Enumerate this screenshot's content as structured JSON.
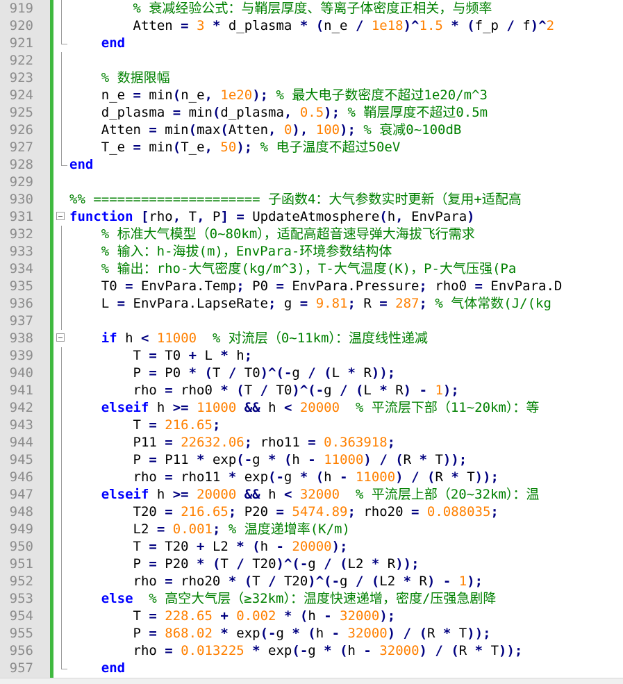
{
  "colors": {
    "keyword": "#0000ff",
    "operator": "#00007f",
    "number": "#ff8000",
    "comment": "#008000",
    "text": "#000000",
    "line_number": "#8c8c8c",
    "gutter": "#e4e4e4",
    "change_bar": "#3fb93f"
  },
  "lines": [
    {
      "n": "919",
      "fold": "vline",
      "html": "        <span class=\"cmt\">% 衰减经验公式：与鞘层厚度、等离子体密度正相关，与频率</span>"
    },
    {
      "n": "920",
      "fold": "vline",
      "html": "        Atten <span class=\"op\">=</span> <span class=\"num\">3</span> <span class=\"op\">*</span> d_plasma <span class=\"op\">*</span> <span class=\"op\">(</span>n_e <span class=\"op\">/</span> <span class=\"num\">1e18</span><span class=\"op\">)^</span><span class=\"num\">1.5</span> <span class=\"op\">*</span> <span class=\"op\">(</span>f_p <span class=\"op\">/</span> f<span class=\"op\">)^</span><span class=\"num\">2</span>"
    },
    {
      "n": "921",
      "fold": "end",
      "html": "    <span class=\"kw\">end</span>"
    },
    {
      "n": "922",
      "fold": "vline",
      "html": ""
    },
    {
      "n": "923",
      "fold": "vline",
      "html": "    <span class=\"cmt\">% 数据限幅</span>"
    },
    {
      "n": "924",
      "fold": "vline",
      "html": "    n_e <span class=\"op\">=</span> min<span class=\"op\">(</span>n_e<span class=\"op\">,</span> <span class=\"num\">1e20</span><span class=\"op\">);</span> <span class=\"cmt\">% 最大电子数密度不超过1e20/m^3</span>"
    },
    {
      "n": "925",
      "fold": "vline",
      "html": "    d_plasma <span class=\"op\">=</span> min<span class=\"op\">(</span>d_plasma<span class=\"op\">,</span> <span class=\"num\">0.5</span><span class=\"op\">);</span> <span class=\"cmt\">% 鞘层厚度不超过0.5m</span>"
    },
    {
      "n": "926",
      "fold": "vline",
      "html": "    Atten <span class=\"op\">=</span> min<span class=\"op\">(</span>max<span class=\"op\">(</span>Atten<span class=\"op\">,</span> <span class=\"num\">0</span><span class=\"op\">),</span> <span class=\"num\">100</span><span class=\"op\">);</span> <span class=\"cmt\">% 衰减0~100dB</span>"
    },
    {
      "n": "927",
      "fold": "vline",
      "html": "    T_e <span class=\"op\">=</span> min<span class=\"op\">(</span>T_e<span class=\"op\">,</span> <span class=\"num\">50</span><span class=\"op\">);</span> <span class=\"cmt\">% 电子温度不超过50eV</span>"
    },
    {
      "n": "928",
      "fold": "end",
      "html": "<span class=\"kw\">end</span>"
    },
    {
      "n": "929",
      "fold": "",
      "html": ""
    },
    {
      "n": "930",
      "fold": "",
      "html": "<span class=\"cmt\">%% ===================== 子函数4：大气参数实时更新（复用+适配高</span>"
    },
    {
      "n": "931",
      "fold": "box",
      "html": "<span class=\"kw\">function</span> <span class=\"op\">[</span>rho<span class=\"op\">,</span> T<span class=\"op\">,</span> P<span class=\"op\">]</span> <span class=\"op\">=</span> UpdateAtmosphere<span class=\"op\">(</span>h<span class=\"op\">,</span> EnvPara<span class=\"op\">)</span>"
    },
    {
      "n": "932",
      "fold": "vline",
      "html": "    <span class=\"cmt\">% 标准大气模型（0~80km），适配高超音速导弹大海拔飞行需求</span>"
    },
    {
      "n": "933",
      "fold": "vline",
      "html": "    <span class=\"cmt\">% 输入：h-海拔(m)，EnvPara-环境参数结构体</span>"
    },
    {
      "n": "934",
      "fold": "vline",
      "html": "    <span class=\"cmt\">% 输出：rho-大气密度(kg/m^3)，T-大气温度(K)，P-大气压强(Pa</span>"
    },
    {
      "n": "935",
      "fold": "vline",
      "html": "    T0 <span class=\"op\">=</span> EnvPara.Temp<span class=\"op\">;</span> P0 <span class=\"op\">=</span> EnvPara.Pressure<span class=\"op\">;</span> rho0 <span class=\"op\">=</span> EnvPara.D"
    },
    {
      "n": "936",
      "fold": "vline",
      "html": "    L <span class=\"op\">=</span> EnvPara.LapseRate<span class=\"op\">;</span> g <span class=\"op\">=</span> <span class=\"num\">9.81</span><span class=\"op\">;</span> R <span class=\"op\">=</span> <span class=\"num\">287</span><span class=\"op\">;</span> <span class=\"cmt\">% 气体常数(J/(kg</span>"
    },
    {
      "n": "937",
      "fold": "vline",
      "html": ""
    },
    {
      "n": "938",
      "fold": "box",
      "html": "    <span class=\"kw\">if</span> h <span class=\"op\">&lt;</span> <span class=\"num\">11000</span>  <span class=\"cmt\">% 对流层（0~11km）：温度线性递减</span>"
    },
    {
      "n": "939",
      "fold": "vline",
      "html": "        T <span class=\"op\">=</span> T0 <span class=\"op\">+</span> L <span class=\"op\">*</span> h<span class=\"op\">;</span>"
    },
    {
      "n": "940",
      "fold": "vline",
      "html": "        P <span class=\"op\">=</span> P0 <span class=\"op\">*</span> <span class=\"op\">(</span>T <span class=\"op\">/</span> T0<span class=\"op\">)^(-</span>g <span class=\"op\">/</span> <span class=\"op\">(</span>L <span class=\"op\">*</span> R<span class=\"op\">));</span>"
    },
    {
      "n": "941",
      "fold": "vline",
      "html": "        rho <span class=\"op\">=</span> rho0 <span class=\"op\">*</span> <span class=\"op\">(</span>T <span class=\"op\">/</span> T0<span class=\"op\">)^(-</span>g <span class=\"op\">/</span> <span class=\"op\">(</span>L <span class=\"op\">*</span> R<span class=\"op\">)</span> <span class=\"op\">-</span> <span class=\"num\">1</span><span class=\"op\">);</span>"
    },
    {
      "n": "942",
      "fold": "vline",
      "html": "    <span class=\"kw\">elseif</span> h <span class=\"op\">&gt;=</span> <span class=\"num\">11000</span> <span class=\"op\">&amp;&amp;</span> h <span class=\"op\">&lt;</span> <span class=\"num\">20000</span>  <span class=\"cmt\">% 平流层下部（11~20km）：等</span>"
    },
    {
      "n": "943",
      "fold": "vline",
      "html": "        T <span class=\"op\">=</span> <span class=\"num\">216.65</span><span class=\"op\">;</span>"
    },
    {
      "n": "944",
      "fold": "vline",
      "html": "        P11 <span class=\"op\">=</span> <span class=\"num\">22632.06</span><span class=\"op\">;</span> rho11 <span class=\"op\">=</span> <span class=\"num\">0.363918</span><span class=\"op\">;</span>"
    },
    {
      "n": "945",
      "fold": "vline",
      "html": "        P <span class=\"op\">=</span> P11 <span class=\"op\">*</span> exp<span class=\"op\">(-</span>g <span class=\"op\">*</span> <span class=\"op\">(</span>h <span class=\"op\">-</span> <span class=\"num\">11000</span><span class=\"op\">)</span> <span class=\"op\">/</span> <span class=\"op\">(</span>R <span class=\"op\">*</span> T<span class=\"op\">));</span>"
    },
    {
      "n": "946",
      "fold": "vline",
      "html": "        rho <span class=\"op\">=</span> rho11 <span class=\"op\">*</span> exp<span class=\"op\">(-</span>g <span class=\"op\">*</span> <span class=\"op\">(</span>h <span class=\"op\">-</span> <span class=\"num\">11000</span><span class=\"op\">)</span> <span class=\"op\">/</span> <span class=\"op\">(</span>R <span class=\"op\">*</span> T<span class=\"op\">));</span>"
    },
    {
      "n": "947",
      "fold": "vline",
      "html": "    <span class=\"kw\">elseif</span> h <span class=\"op\">&gt;=</span> <span class=\"num\">20000</span> <span class=\"op\">&amp;&amp;</span> h <span class=\"op\">&lt;</span> <span class=\"num\">32000</span>  <span class=\"cmt\">% 平流层上部（20~32km）：温</span>"
    },
    {
      "n": "948",
      "fold": "vline",
      "html": "        T20 <span class=\"op\">=</span> <span class=\"num\">216.65</span><span class=\"op\">;</span> P20 <span class=\"op\">=</span> <span class=\"num\">5474.89</span><span class=\"op\">;</span> rho20 <span class=\"op\">=</span> <span class=\"num\">0.088035</span><span class=\"op\">;</span>"
    },
    {
      "n": "949",
      "fold": "vline",
      "html": "        L2 <span class=\"op\">=</span> <span class=\"num\">0.001</span><span class=\"op\">;</span> <span class=\"cmt\">% 温度递增率(K/m)</span>"
    },
    {
      "n": "950",
      "fold": "vline",
      "html": "        T <span class=\"op\">=</span> T20 <span class=\"op\">+</span> L2 <span class=\"op\">*</span> <span class=\"op\">(</span>h <span class=\"op\">-</span> <span class=\"num\">20000</span><span class=\"op\">);</span>"
    },
    {
      "n": "951",
      "fold": "vline",
      "html": "        P <span class=\"op\">=</span> P20 <span class=\"op\">*</span> <span class=\"op\">(</span>T <span class=\"op\">/</span> T20<span class=\"op\">)^(-</span>g <span class=\"op\">/</span> <span class=\"op\">(</span>L2 <span class=\"op\">*</span> R<span class=\"op\">));</span>"
    },
    {
      "n": "952",
      "fold": "vline",
      "html": "        rho <span class=\"op\">=</span> rho20 <span class=\"op\">*</span> <span class=\"op\">(</span>T <span class=\"op\">/</span> T20<span class=\"op\">)^(-</span>g <span class=\"op\">/</span> <span class=\"op\">(</span>L2 <span class=\"op\">*</span> R<span class=\"op\">)</span> <span class=\"op\">-</span> <span class=\"num\">1</span><span class=\"op\">);</span>"
    },
    {
      "n": "953",
      "fold": "vline",
      "html": "    <span class=\"kw\">else</span>  <span class=\"cmt\">% 高空大气层（≥32km）：温度快速递增，密度/压强急剧降</span>"
    },
    {
      "n": "954",
      "fold": "vline",
      "html": "        T <span class=\"op\">=</span> <span class=\"num\">228.65</span> <span class=\"op\">+</span> <span class=\"num\">0.002</span> <span class=\"op\">*</span> <span class=\"op\">(</span>h <span class=\"op\">-</span> <span class=\"num\">32000</span><span class=\"op\">);</span>"
    },
    {
      "n": "955",
      "fold": "vline",
      "html": "        P <span class=\"op\">=</span> <span class=\"num\">868.02</span> <span class=\"op\">*</span> exp<span class=\"op\">(-</span>g <span class=\"op\">*</span> <span class=\"op\">(</span>h <span class=\"op\">-</span> <span class=\"num\">32000</span><span class=\"op\">)</span> <span class=\"op\">/</span> <span class=\"op\">(</span>R <span class=\"op\">*</span> T<span class=\"op\">));</span>"
    },
    {
      "n": "956",
      "fold": "vline",
      "html": "        rho <span class=\"op\">=</span> <span class=\"num\">0.013225</span> <span class=\"op\">*</span> exp<span class=\"op\">(-</span>g <span class=\"op\">*</span> <span class=\"op\">(</span>h <span class=\"op\">-</span> <span class=\"num\">32000</span><span class=\"op\">)</span> <span class=\"op\">/</span> <span class=\"op\">(</span>R <span class=\"op\">*</span> T<span class=\"op\">));</span>"
    },
    {
      "n": "957",
      "fold": "end",
      "html": "    <span class=\"kw\">end</span>"
    }
  ]
}
